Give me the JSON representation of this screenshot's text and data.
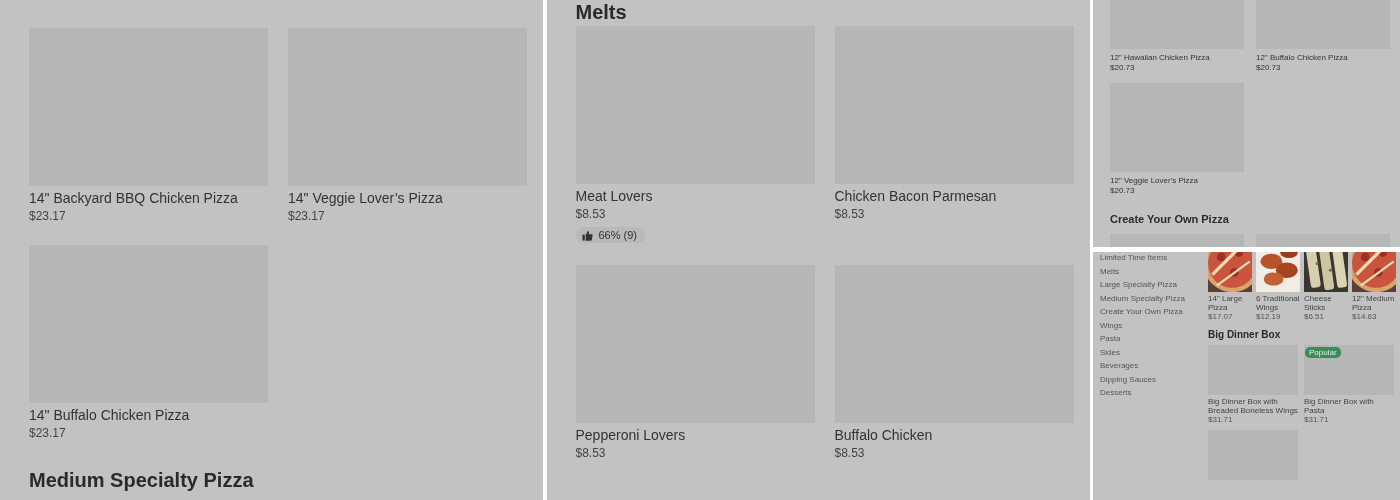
{
  "panels": [
    {
      "blocks": [
        {
          "kind": "cards",
          "items": [
            {
              "name": "14\" Backyard BBQ Chicken Pizza",
              "price": "$23.17",
              "kind": "placeholder"
            },
            {
              "name": "14\" Veggie Lover’s Pizza",
              "price": "$23.17",
              "kind": "placeholder"
            },
            {
              "name": "14\" Buffalo Chicken Pizza",
              "price": "$23.17",
              "kind": "placeholder"
            }
          ]
        },
        {
          "kind": "heading",
          "text": "Medium Specialty Pizza"
        }
      ]
    },
    {
      "blocks": [
        {
          "kind": "heading",
          "text": "Melts"
        },
        {
          "kind": "cards",
          "items": [
            {
              "name": "Meat Lovers",
              "price": "$8.53",
              "rating": "66% (9)",
              "kind": "placeholder"
            },
            {
              "name": "Chicken Bacon Parmesan",
              "price": "$8.53",
              "kind": "placeholder"
            },
            {
              "name": "Pepperoni Lovers",
              "price": "$8.53",
              "kind": "placeholder"
            },
            {
              "name": "Buffalo Chicken",
              "price": "$8.53",
              "kind": "placeholder"
            }
          ]
        }
      ]
    },
    {
      "blocks": [
        {
          "kind": "cards",
          "items": [
            {
              "name": "12\" Hawaiian Chicken Pizza",
              "price": "$20.73",
              "kind": "placeholder"
            },
            {
              "name": "12\" Buffalo Chicken Pizza",
              "price": "$20.73",
              "kind": "placeholder"
            },
            {
              "name": "12\" Veggie Lover's Pizza",
              "price": "$20.73",
              "kind": "placeholder"
            }
          ]
        },
        {
          "kind": "heading",
          "text": "Create Your Own Pizza"
        },
        {
          "kind": "cards",
          "items": [
            {
              "kind": "placeholder"
            },
            {
              "kind": "placeholder"
            }
          ]
        }
      ]
    },
    {
      "sidebar": [
        "Limited Time Items",
        "Melts",
        "Large Specialty Pizza",
        "Medium Specialty Pizza",
        "Create Your Own Pizza",
        "Wings",
        "Pasta",
        "Sides",
        "Beverages",
        "Dipping Sauces",
        "Desserts"
      ],
      "blocks": [
        {
          "kind": "thumbs",
          "items": [
            {
              "name": "14\" Large Pizza",
              "price": "$17.07",
              "kind": "picture"
            },
            {
              "name": "6 Traditional Wings",
              "price": "$12.19",
              "kind": "picture"
            },
            {
              "name": "Cheese Sticks",
              "price": "$6.51",
              "kind": "picture"
            },
            {
              "name": "12\" Medium Pizza",
              "price": "$14.63",
              "kind": "picture"
            }
          ]
        },
        {
          "kind": "heading",
          "text": "Big Dinner Box"
        },
        {
          "kind": "cards",
          "items": [
            {
              "name": "Big Dinner Box with Breaded Boneless Wings",
              "price": "$31.71",
              "kind": "placeholder"
            },
            {
              "name": "Big Dinner Box with Pasta",
              "price": "$31.71",
              "badge": "Popular",
              "kind": "placeholder"
            },
            {
              "kind": "placeholder"
            }
          ]
        }
      ]
    }
  ]
}
